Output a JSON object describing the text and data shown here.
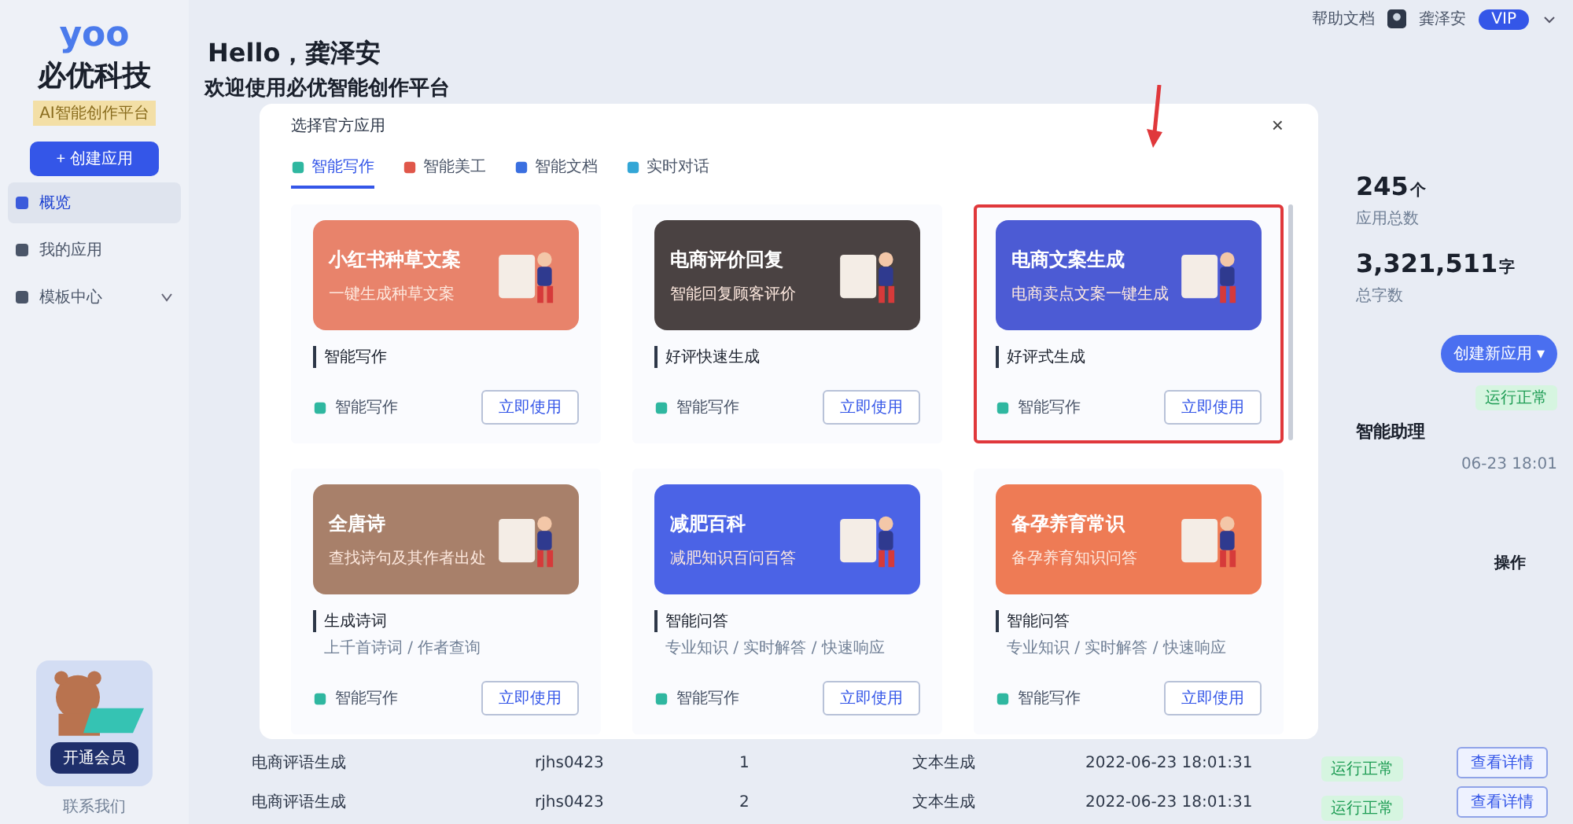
{
  "sidebar": {
    "logo": "yoo",
    "brand": "必优科技",
    "badge": "AI智能创作平台",
    "create_button": "+ 创建应用",
    "items": [
      {
        "label": "概览",
        "selected": true,
        "kind": "link"
      },
      {
        "label": "我的应用",
        "selected": false,
        "kind": "link"
      },
      {
        "label": "模板中心",
        "selected": false,
        "kind": "group"
      }
    ],
    "promo_button": "开通会员",
    "footer": "联系我们"
  },
  "topbar": {
    "help": "帮助文档",
    "user": "龚泽安",
    "vip": "VIP"
  },
  "greeting": {
    "hello": "Hello，龚泽安",
    "welcome": "欢迎使用必优智能创作平台"
  },
  "stats": [
    {
      "value": "245",
      "unit": "个",
      "label": "应用总数"
    },
    {
      "value": "3,321,511",
      "unit": "字",
      "label": "总字数"
    }
  ],
  "side_panel": {
    "create_button": "创建新应用 ▾",
    "status": "运行正常",
    "app_name": "智能助理",
    "time": "06-23 18:01",
    "action_header": "操作"
  },
  "table": {
    "rows": [
      {
        "name": "电商评语生成",
        "id": "rjhs0423",
        "count": "1",
        "type": "文本生成",
        "time": "2022-06-23 18:01:31",
        "status": "运行正常",
        "action": "查看详情"
      },
      {
        "name": "电商评语生成",
        "id": "rjhs0423",
        "count": "2",
        "type": "文本生成",
        "time": "2022-06-23 18:01:31",
        "status": "运行正常",
        "action": "查看详情"
      }
    ]
  },
  "modal": {
    "title": "选择官方应用",
    "close": "×",
    "tabs": [
      {
        "label": "智能写作",
        "selected": true,
        "color": "#2fb7a0"
      },
      {
        "label": "智能美工",
        "selected": false,
        "color": "#e0574a"
      },
      {
        "label": "智能文档",
        "selected": false,
        "color": "#3a6fe0"
      },
      {
        "label": "实时对话",
        "selected": false,
        "color": "#33a6d6"
      }
    ],
    "cards": [
      {
        "title": "小红书种草文案",
        "subtitle": "一键生成种草文案",
        "color": "#e8836b",
        "tag": "智能写作",
        "footer": "智能写作",
        "button": "立即使用",
        "highlighted": false
      },
      {
        "title": "电商评价回复",
        "subtitle": "智能回复顾客评价",
        "color": "#4a4242",
        "tag": "好评快速生成",
        "footer": "智能写作",
        "button": "立即使用",
        "highlighted": false
      },
      {
        "title": "电商文案生成",
        "subtitle": "电商卖点文案一键生成",
        "color": "#4c5bd4",
        "tag": "好评式生成",
        "footer": "智能写作",
        "button": "立即使用",
        "highlighted": true
      },
      {
        "title": "全唐诗",
        "subtitle": "查找诗句及其作者出处",
        "color": "#a8806a",
        "tag": "生成诗词",
        "desc": "上千首诗词 / 作者查询",
        "footer": "智能写作",
        "button": "立即使用",
        "highlighted": false
      },
      {
        "title": "减肥百科",
        "subtitle": "减肥知识百问百答",
        "color": "#4b63e6",
        "tag": "智能问答",
        "desc": "专业知识 / 实时解答 / 快速响应",
        "footer": "智能写作",
        "button": "立即使用",
        "highlighted": false
      },
      {
        "title": "备孕养育常识",
        "subtitle": "备孕养育知识问答",
        "color": "#ee7b55",
        "tag": "智能问答",
        "desc": "专业知识 / 实时解答 / 快速响应",
        "footer": "智能写作",
        "button": "立即使用",
        "highlighted": false
      }
    ]
  }
}
